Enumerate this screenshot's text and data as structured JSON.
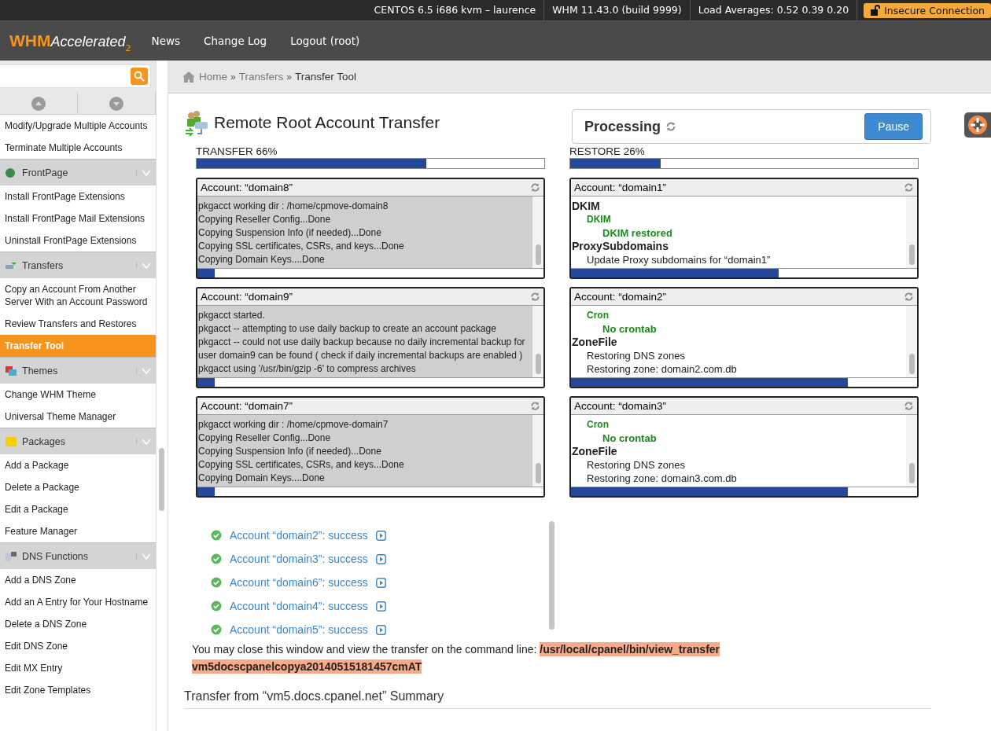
{
  "top_bar": {
    "items": [
      "CENTOS 6.5 i686 kvm – laurence",
      "WHM 11.43.0 (build 9999)",
      "Load Averages: 0.52 0.39 0.20"
    ],
    "badge": "Insecure Connection"
  },
  "header": {
    "logo": {
      "main": "WHM",
      "suffix": "Accelerated",
      "version": "2"
    },
    "nav": [
      "News",
      "Change Log",
      "Logout (root)"
    ]
  },
  "sidebar": {
    "items": [
      {
        "kind": "link",
        "label": "Modify/Upgrade Multiple Accounts",
        "selected": false
      },
      {
        "kind": "link",
        "label": "Terminate Multiple Accounts",
        "selected": false
      },
      {
        "kind": "section",
        "label": "FrontPage"
      },
      {
        "kind": "link",
        "label": "Install FrontPage Extensions",
        "selected": false
      },
      {
        "kind": "link",
        "label": "Install FrontPage Mail Extensions",
        "selected": false
      },
      {
        "kind": "link",
        "label": "Uninstall FrontPage Extensions",
        "selected": false
      },
      {
        "kind": "section",
        "label": "Transfers"
      },
      {
        "kind": "link",
        "label": "Copy an Account From Another Server With an Account Password",
        "selected": false
      },
      {
        "kind": "link",
        "label": "Review Transfers and Restores",
        "selected": false
      },
      {
        "kind": "link",
        "label": "Transfer Tool",
        "selected": true
      },
      {
        "kind": "section",
        "label": "Themes"
      },
      {
        "kind": "link",
        "label": "Change WHM Theme",
        "selected": false
      },
      {
        "kind": "link",
        "label": "Universal Theme Manager",
        "selected": false
      },
      {
        "kind": "section",
        "label": "Packages"
      },
      {
        "kind": "link",
        "label": "Add a Package",
        "selected": false
      },
      {
        "kind": "link",
        "label": "Delete a Package",
        "selected": false
      },
      {
        "kind": "link",
        "label": "Edit a Package",
        "selected": false
      },
      {
        "kind": "link",
        "label": "Feature Manager",
        "selected": false
      },
      {
        "kind": "section",
        "label": "DNS Functions"
      },
      {
        "kind": "link",
        "label": "Add a DNS Zone",
        "selected": false
      },
      {
        "kind": "link",
        "label": "Add an A Entry for Your Hostname",
        "selected": false
      },
      {
        "kind": "link",
        "label": "Delete a DNS Zone",
        "selected": false
      },
      {
        "kind": "link",
        "label": "Edit DNS Zone",
        "selected": false
      },
      {
        "kind": "link",
        "label": "Edit MX Entry",
        "selected": false
      },
      {
        "kind": "link",
        "label": "Edit Zone Templates",
        "selected": false
      }
    ]
  },
  "breadcrumb": {
    "separator": "»",
    "items": [
      "Home",
      "Transfers",
      "Transfer Tool"
    ]
  },
  "page_title": "Remote Root Account Transfer",
  "status": {
    "label": "Processing",
    "button": "Pause"
  },
  "columns": [
    {
      "label": "TRANSFER 66%",
      "level": 0.66,
      "boxes": [
        {
          "title": "Account: “domain8”",
          "highlighted": true,
          "level": 0.05,
          "lines": [
            {
              "kind": "text",
              "text": "pkgacct working dir : /home/cpmove-domain8"
            },
            {
              "kind": "text",
              "text": "Copying Reseller Config...Done"
            },
            {
              "kind": "text",
              "text": "Copying Suspension Info (if needed)...Done"
            },
            {
              "kind": "text",
              "text": "Copying SSL certificates, CSRs, and keys...Done"
            },
            {
              "kind": "text",
              "text": "Copying Domain Keys....Done"
            }
          ]
        },
        {
          "title": "Account: “domain9”",
          "highlighted": true,
          "level": 0.05,
          "lines": [
            {
              "kind": "text",
              "text": "pkgacct started."
            },
            {
              "kind": "text",
              "text": "pkgacct -- attempting to use daily backup to create an account package"
            },
            {
              "kind": "text",
              "text": "pkgacct -- could not use daily backup because no daily incremental backup for user domain9 can be found ( check if daily incremental backups are enabled )"
            },
            {
              "kind": "text",
              "text": "pkgacct using '/usr/bin/gzip -6' to compress archives"
            }
          ]
        },
        {
          "title": "Account: “domain7”",
          "highlighted": true,
          "level": 0.05,
          "lines": [
            {
              "kind": "text",
              "text": "pkgacct working dir : /home/cpmove-domain7"
            },
            {
              "kind": "text",
              "text": "Copying Reseller Config...Done"
            },
            {
              "kind": "text",
              "text": "Copying Suspension Info (if needed)...Done"
            },
            {
              "kind": "text",
              "text": "Copying SSL certificates, CSRs, and keys...Done"
            },
            {
              "kind": "text",
              "text": "Copying Domain Keys....Done"
            }
          ]
        }
      ]
    },
    {
      "label": "RESTORE 26%",
      "level": 0.26,
      "boxes": [
        {
          "title": "Account: “domain1”",
          "highlighted": false,
          "level": 0.6,
          "lines": [
            {
              "kind": "heading",
              "text": "DKIM"
            },
            {
              "kind": "subheading",
              "text": "DKIM"
            },
            {
              "kind": "result",
              "text": "DKIM restored"
            },
            {
              "kind": "heading",
              "text": "ProxySubdomains"
            },
            {
              "kind": "step",
              "text": "Update Proxy subdomains for “domain1”"
            }
          ]
        },
        {
          "title": "Account: “domain2”",
          "highlighted": false,
          "level": 0.8,
          "lines": [
            {
              "kind": "subheading",
              "text": "Cron"
            },
            {
              "kind": "result",
              "text": "No crontab"
            },
            {
              "kind": "heading",
              "text": "ZoneFile"
            },
            {
              "kind": "step",
              "text": "Restoring DNS zones"
            },
            {
              "kind": "step",
              "text": "Restoring zone: domain2.com.db"
            }
          ]
        },
        {
          "title": "Account: “domain3”",
          "highlighted": false,
          "level": 0.8,
          "lines": [
            {
              "kind": "subheading",
              "text": "Cron"
            },
            {
              "kind": "result",
              "text": "No crontab"
            },
            {
              "kind": "heading",
              "text": "ZoneFile"
            },
            {
              "kind": "step",
              "text": "Restoring DNS zones"
            },
            {
              "kind": "step",
              "text": "Restoring zone: domain3.com.db"
            }
          ]
        }
      ]
    }
  ],
  "results": [
    "Account “domain2”: success",
    "Account “domain3”: success",
    "Account “domain6”: success",
    "Account “domain4”: success",
    "Account “domain5”: success"
  ],
  "note": {
    "message": "You may close this window and view the transfer on the command line:",
    "command": "/usr/local/cpanel/bin/view_transfer vm5docscpanelcopya20140515181457cmAT"
  },
  "summary_title": "Transfer from “vm5.docs.cpanel.net” Summary"
}
